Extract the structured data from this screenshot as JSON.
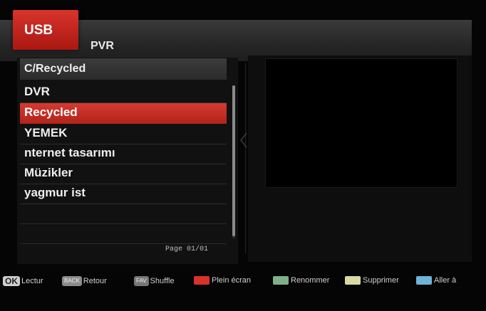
{
  "header": {
    "tab_usb": "USB",
    "tab_pvr": "PVR"
  },
  "browser": {
    "path": "C/Recycled",
    "items": [
      {
        "label": "DVR",
        "selected": false
      },
      {
        "label": "Recycled",
        "selected": true
      },
      {
        "label": "YEMEK",
        "selected": false
      },
      {
        "label": "nternet tasarımı",
        "selected": false
      },
      {
        "label": "Müzikler",
        "selected": false
      },
      {
        "label": "yagmur ist",
        "selected": false
      },
      {
        "label": "",
        "selected": false
      },
      {
        "label": "",
        "selected": false
      }
    ],
    "page": "Page 01/01"
  },
  "footer": {
    "ok": {
      "key": "OK",
      "label": "Lectur"
    },
    "back": {
      "key": "BACK",
      "label": "Retour"
    },
    "fav": {
      "key": "FAV",
      "label": "Shuffle"
    },
    "red": {
      "label": "Plein écran",
      "color": "#d8322a"
    },
    "green": {
      "label": "Renommer",
      "color": "#7fb08a"
    },
    "yellow": {
      "label": "Supprimer",
      "color": "#d9d9a6"
    },
    "blue": {
      "label": "Aller à",
      "color": "#6fb3d9"
    }
  },
  "colors": {
    "accent": "#c62a21",
    "background": "#050505"
  }
}
